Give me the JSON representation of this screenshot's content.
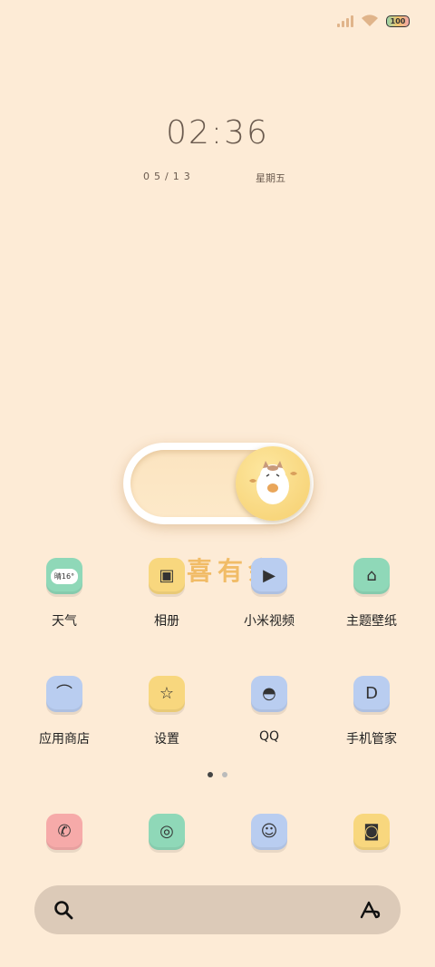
{
  "status": {
    "battery": "100"
  },
  "lockscreen": {
    "time": "02:36",
    "date": "05/13",
    "weekday": "星期五"
  },
  "widget": {
    "text": "欢喜有余"
  },
  "apps_row1": [
    {
      "label": "天气",
      "icon": "weather-icon",
      "color": "#8fd8b8",
      "glyph": "晴16°"
    },
    {
      "label": "相册",
      "icon": "gallery-icon",
      "color": "#f8d77e",
      "glyph": "▣"
    },
    {
      "label": "小米视频",
      "icon": "video-icon",
      "color": "#b9cdf0",
      "glyph": "▶"
    },
    {
      "label": "主题壁纸",
      "icon": "theme-icon",
      "color": "#8fd8b8",
      "glyph": "⌂"
    }
  ],
  "apps_row2": [
    {
      "label": "应用商店",
      "icon": "app-store-icon",
      "color": "#b9cdf0",
      "glyph": "⌒"
    },
    {
      "label": "设置",
      "icon": "settings-icon",
      "color": "#f8d77e",
      "glyph": "☆"
    },
    {
      "label": "QQ",
      "icon": "qq-icon",
      "color": "#b9cdf0",
      "glyph": "◓"
    },
    {
      "label": "手机管家",
      "icon": "security-icon",
      "color": "#b9cdf0",
      "glyph": "D"
    }
  ],
  "dock": [
    {
      "icon": "phone-icon",
      "color": "#f6aaa9",
      "glyph": "✆"
    },
    {
      "icon": "browser-icon",
      "color": "#8fd8b8",
      "glyph": "◎"
    },
    {
      "icon": "messages-icon",
      "color": "#b9cdf0",
      "glyph": "☺"
    },
    {
      "icon": "camera-icon",
      "color": "#f8d77e",
      "glyph": "◙"
    }
  ]
}
